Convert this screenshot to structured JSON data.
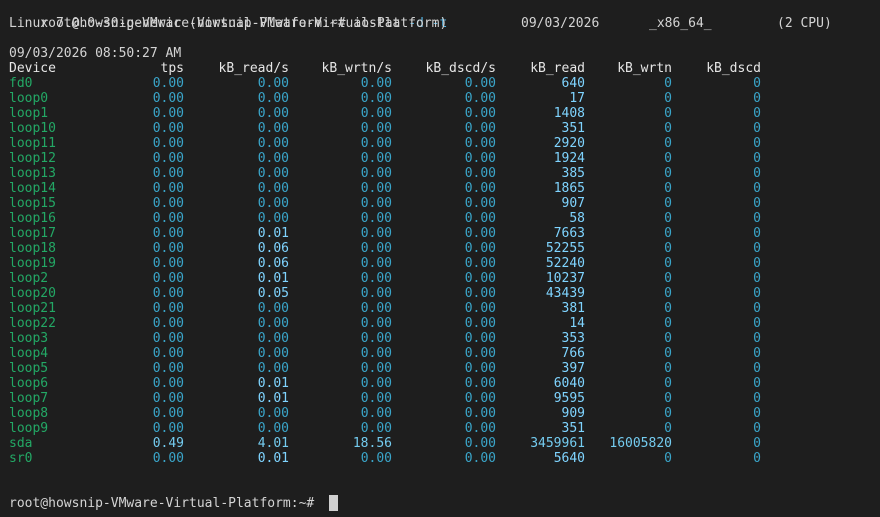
{
  "terminal": {
    "top_prompt": "root@howsnip-VMware-Virtual-Platform:~#",
    "command_name": "iostat",
    "command_opts": "-d -t",
    "sysinfo_kernel": "Linux 7.0.0-30-generic (howsnip-VMware-Virtual-Platform)",
    "sysinfo_date": "09/03/2026",
    "sysinfo_arch": "_x86_64_",
    "sysinfo_cpu": "(2 CPU)",
    "timestamp": "09/03/2026 08:50:27 AM",
    "headers": [
      "Device",
      "tps",
      "kB_read/s",
      "kB_wrtn/s",
      "kB_dscd/s",
      "kB_read",
      "kB_wrtn",
      "kB_dscd"
    ],
    "rows": [
      [
        "fd0",
        "0.00",
        "0.00",
        "0.00",
        "0.00",
        "640",
        "0",
        "0"
      ],
      [
        "loop0",
        "0.00",
        "0.00",
        "0.00",
        "0.00",
        "17",
        "0",
        "0"
      ],
      [
        "loop1",
        "0.00",
        "0.00",
        "0.00",
        "0.00",
        "1408",
        "0",
        "0"
      ],
      [
        "loop10",
        "0.00",
        "0.00",
        "0.00",
        "0.00",
        "351",
        "0",
        "0"
      ],
      [
        "loop11",
        "0.00",
        "0.00",
        "0.00",
        "0.00",
        "2920",
        "0",
        "0"
      ],
      [
        "loop12",
        "0.00",
        "0.00",
        "0.00",
        "0.00",
        "1924",
        "0",
        "0"
      ],
      [
        "loop13",
        "0.00",
        "0.00",
        "0.00",
        "0.00",
        "385",
        "0",
        "0"
      ],
      [
        "loop14",
        "0.00",
        "0.00",
        "0.00",
        "0.00",
        "1865",
        "0",
        "0"
      ],
      [
        "loop15",
        "0.00",
        "0.00",
        "0.00",
        "0.00",
        "907",
        "0",
        "0"
      ],
      [
        "loop16",
        "0.00",
        "0.00",
        "0.00",
        "0.00",
        "58",
        "0",
        "0"
      ],
      [
        "loop17",
        "0.00",
        "0.01",
        "0.00",
        "0.00",
        "7663",
        "0",
        "0"
      ],
      [
        "loop18",
        "0.00",
        "0.06",
        "0.00",
        "0.00",
        "52255",
        "0",
        "0"
      ],
      [
        "loop19",
        "0.00",
        "0.06",
        "0.00",
        "0.00",
        "52240",
        "0",
        "0"
      ],
      [
        "loop2",
        "0.00",
        "0.01",
        "0.00",
        "0.00",
        "10237",
        "0",
        "0"
      ],
      [
        "loop20",
        "0.00",
        "0.05",
        "0.00",
        "0.00",
        "43439",
        "0",
        "0"
      ],
      [
        "loop21",
        "0.00",
        "0.00",
        "0.00",
        "0.00",
        "381",
        "0",
        "0"
      ],
      [
        "loop22",
        "0.00",
        "0.00",
        "0.00",
        "0.00",
        "14",
        "0",
        "0"
      ],
      [
        "loop3",
        "0.00",
        "0.00",
        "0.00",
        "0.00",
        "353",
        "0",
        "0"
      ],
      [
        "loop4",
        "0.00",
        "0.00",
        "0.00",
        "0.00",
        "766",
        "0",
        "0"
      ],
      [
        "loop5",
        "0.00",
        "0.00",
        "0.00",
        "0.00",
        "397",
        "0",
        "0"
      ],
      [
        "loop6",
        "0.00",
        "0.01",
        "0.00",
        "0.00",
        "6040",
        "0",
        "0"
      ],
      [
        "loop7",
        "0.00",
        "0.01",
        "0.00",
        "0.00",
        "9595",
        "0",
        "0"
      ],
      [
        "loop8",
        "0.00",
        "0.00",
        "0.00",
        "0.00",
        "909",
        "0",
        "0"
      ],
      [
        "loop9",
        "0.00",
        "0.00",
        "0.00",
        "0.00",
        "351",
        "0",
        "0"
      ],
      [
        "sda",
        "0.49",
        "4.01",
        "18.56",
        "0.00",
        "3459961",
        "16005820",
        "0"
      ],
      [
        "sr0",
        "0.00",
        "0.01",
        "0.00",
        "0.00",
        "5640",
        "0",
        "0"
      ]
    ],
    "bottom_prompt": "root@howsnip-VMware-Virtual-Platform:~#"
  },
  "colors": {
    "background": "#1e1e1e",
    "text": "#d4d4d4",
    "device": "#23a865",
    "number_dim": "#3aa5c9",
    "number_bright": "#7fd4ff"
  }
}
